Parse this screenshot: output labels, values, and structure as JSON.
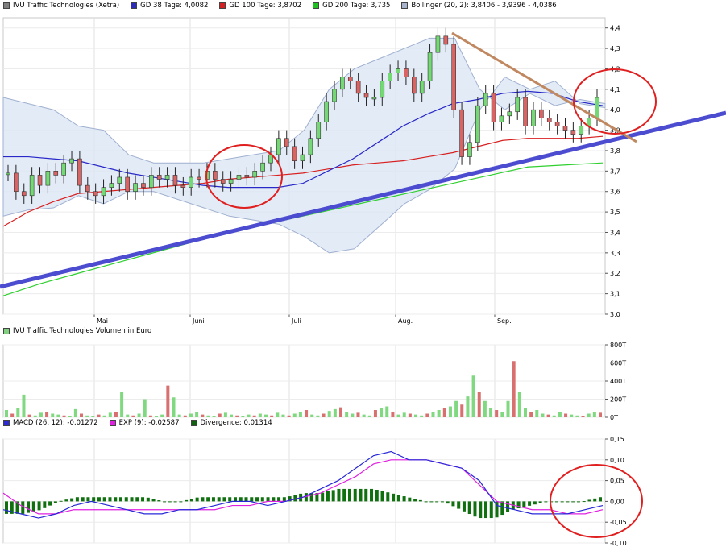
{
  "legend_top": [
    {
      "label": "IVU Traffic Technologies (Xetra)",
      "color": "#7f7f7f"
    },
    {
      "label": "GD 38 Tage: 4,0082",
      "color": "#2c2cb4"
    },
    {
      "label": "GD 100 Tage: 3,8702",
      "color": "#d42020"
    },
    {
      "label": "GD 200 Tage: 3,735",
      "color": "#20c020"
    },
    {
      "label": "Bollinger (20, 2): 3,8406 - 3,9396 - 4,0386",
      "color": "#a8b4cc"
    }
  ],
  "legend_volume": [
    {
      "label": "IVU Traffic Technologies Volumen in Euro",
      "color": "#80d080"
    }
  ],
  "legend_macd": [
    {
      "label": "MACD (26, 12): -0,01272",
      "color": "#2c2cd0"
    },
    {
      "label": "EXP (9): -0,02587",
      "color": "#e020e0"
    },
    {
      "label": "Divergence: 0,01314",
      "color": "#106010"
    }
  ],
  "chart_data": [
    {
      "type": "candlestick",
      "x_labels": [
        "Mai",
        "Juni",
        "Juli",
        "Aug.",
        "Sep."
      ],
      "y_ticks": [
        "3,0",
        "3,1",
        "3,2",
        "3,3",
        "3,4",
        "3,5",
        "3,6",
        "3,7",
        "3,8",
        "3,9",
        "4,0",
        "4,1",
        "4,2",
        "4,3",
        "4,4"
      ],
      "ylim": [
        3.0,
        4.45
      ],
      "series": [
        {
          "name": "GD 38 Tage",
          "values": [
            3.77,
            3.77,
            3.76,
            3.75,
            3.72,
            3.69,
            3.67,
            3.65,
            3.63,
            3.62,
            3.62,
            3.62,
            3.64,
            3.7,
            3.76,
            3.84,
            3.92,
            3.98,
            4.03,
            4.05,
            4.08,
            4.09,
            4.08,
            4.04,
            4.02
          ]
        },
        {
          "name": "GD 100 Tage",
          "values": [
            3.43,
            3.5,
            3.55,
            3.59,
            3.6,
            3.61,
            3.62,
            3.63,
            3.64,
            3.66,
            3.67,
            3.68,
            3.69,
            3.71,
            3.73,
            3.74,
            3.75,
            3.77,
            3.79,
            3.82,
            3.85,
            3.86,
            3.86,
            3.86,
            3.87
          ]
        },
        {
          "name": "GD 200 Tage",
          "values": [
            3.09,
            3.15,
            3.2,
            3.25,
            3.3,
            3.35,
            3.4,
            3.44,
            3.48,
            3.52,
            3.56,
            3.6,
            3.64,
            3.68,
            3.72,
            3.73,
            3.74
          ]
        },
        {
          "name": "Bollinger",
          "values": [
            4.06,
            4.03,
            4.0,
            3.92,
            3.9,
            3.78,
            3.74,
            3.74,
            3.74,
            3.76,
            3.78,
            3.8,
            3.9,
            4.1,
            4.2,
            4.25,
            4.3,
            4.35,
            4.35,
            4.1,
            4.0,
            4.08,
            4.02,
            4.05,
            4.03
          ]
        }
      ],
      "candles": [
        3.69,
        3.6,
        3.58,
        3.68,
        3.63,
        3.7,
        3.68,
        3.74,
        3.76,
        3.63,
        3.6,
        3.58,
        3.62,
        3.64,
        3.67,
        3.6,
        3.64,
        3.62,
        3.68,
        3.66,
        3.68,
        3.63,
        3.62,
        3.67,
        3.66,
        3.7,
        3.66,
        3.64,
        3.66,
        3.68,
        3.67,
        3.7,
        3.74,
        3.78,
        3.86,
        3.82,
        3.75,
        3.78,
        3.86,
        3.94,
        4.04,
        4.1,
        4.16,
        4.14,
        4.08,
        4.06,
        4.06,
        4.14,
        4.18,
        4.2,
        4.16,
        4.08,
        4.14,
        4.28,
        4.36,
        4.32,
        4.0,
        3.77,
        3.84,
        4.02,
        4.08,
        3.94,
        3.97,
        3.99,
        4.06,
        3.92,
        4.0,
        3.96,
        3.94,
        3.92,
        3.9,
        3.88,
        3.92,
        3.96,
        4.06
      ],
      "trend_lines": [
        "blue support",
        "brown resistance"
      ],
      "annotations": [
        "red ellipse June",
        "red ellipse September"
      ]
    },
    {
      "type": "bar",
      "y_ticks": [
        "0T",
        "200T",
        "400T",
        "600T",
        "800T"
      ],
      "ylim": [
        0,
        800
      ],
      "values": [
        80,
        40,
        100,
        250,
        30,
        20,
        50,
        60,
        40,
        30,
        20,
        10,
        90,
        40,
        20,
        10,
        30,
        20,
        50,
        60,
        280,
        30,
        20,
        40,
        200,
        20,
        10,
        30,
        350,
        220,
        30,
        20,
        40,
        60,
        30,
        20,
        10,
        40,
        50,
        30,
        20,
        10,
        30,
        20,
        40,
        30,
        20,
        50,
        30,
        20,
        40,
        60,
        80,
        30,
        20,
        40,
        70,
        90,
        110,
        60,
        40,
        50,
        30,
        20,
        80,
        100,
        120,
        60,
        30,
        50,
        40,
        30,
        20,
        40,
        60,
        80,
        100,
        120,
        180,
        140,
        230,
        460,
        280,
        180,
        100,
        80,
        60,
        180,
        620,
        280,
        100,
        60,
        80,
        40,
        30,
        20,
        60,
        40,
        30,
        20,
        10,
        40,
        60,
        50
      ]
    },
    {
      "type": "line",
      "y_ticks": [
        "0,15",
        "0,10",
        "0,05",
        "0,00",
        "-0,05",
        "-0,10"
      ],
      "ylim": [
        -0.1,
        0.15
      ],
      "series": [
        {
          "name": "MACD (26, 12)",
          "values": [
            -0.02,
            -0.03,
            -0.04,
            -0.03,
            -0.01,
            0.0,
            -0.01,
            -0.02,
            -0.03,
            -0.03,
            -0.02,
            -0.02,
            -0.01,
            0.0,
            0.0,
            -0.01,
            0.0,
            0.01,
            0.03,
            0.05,
            0.08,
            0.11,
            0.12,
            0.1,
            0.1,
            0.09,
            0.08,
            0.05,
            -0.01,
            -0.02,
            -0.03,
            -0.03,
            -0.03,
            -0.02,
            -0.01
          ]
        },
        {
          "name": "EXP (9)",
          "values": [
            0.02,
            -0.01,
            -0.03,
            -0.03,
            -0.02,
            -0.02,
            -0.02,
            -0.02,
            -0.02,
            -0.02,
            -0.02,
            -0.02,
            -0.02,
            -0.01,
            -0.01,
            0.0,
            0.0,
            0.01,
            0.02,
            0.04,
            0.06,
            0.09,
            0.1,
            0.1,
            0.1,
            0.09,
            0.08,
            0.04,
            0.0,
            -0.01,
            -0.02,
            -0.02,
            -0.03,
            -0.03,
            -0.02
          ]
        },
        {
          "name": "Divergence",
          "values": [
            -0.03,
            -0.03,
            -0.02,
            0.0,
            0.01,
            0.01,
            0.01,
            0.01,
            0.01,
            0.0,
            0.0,
            0.01,
            0.01,
            0.01,
            0.01,
            0.01,
            0.01,
            0.02,
            0.02,
            0.03,
            0.03,
            0.03,
            0.02,
            0.01,
            0.0,
            0.0,
            -0.02,
            -0.04,
            -0.04,
            -0.02,
            -0.01,
            0.0,
            0.0,
            0.0,
            0.01
          ]
        }
      ],
      "annotations": [
        "red ellipse"
      ]
    }
  ]
}
